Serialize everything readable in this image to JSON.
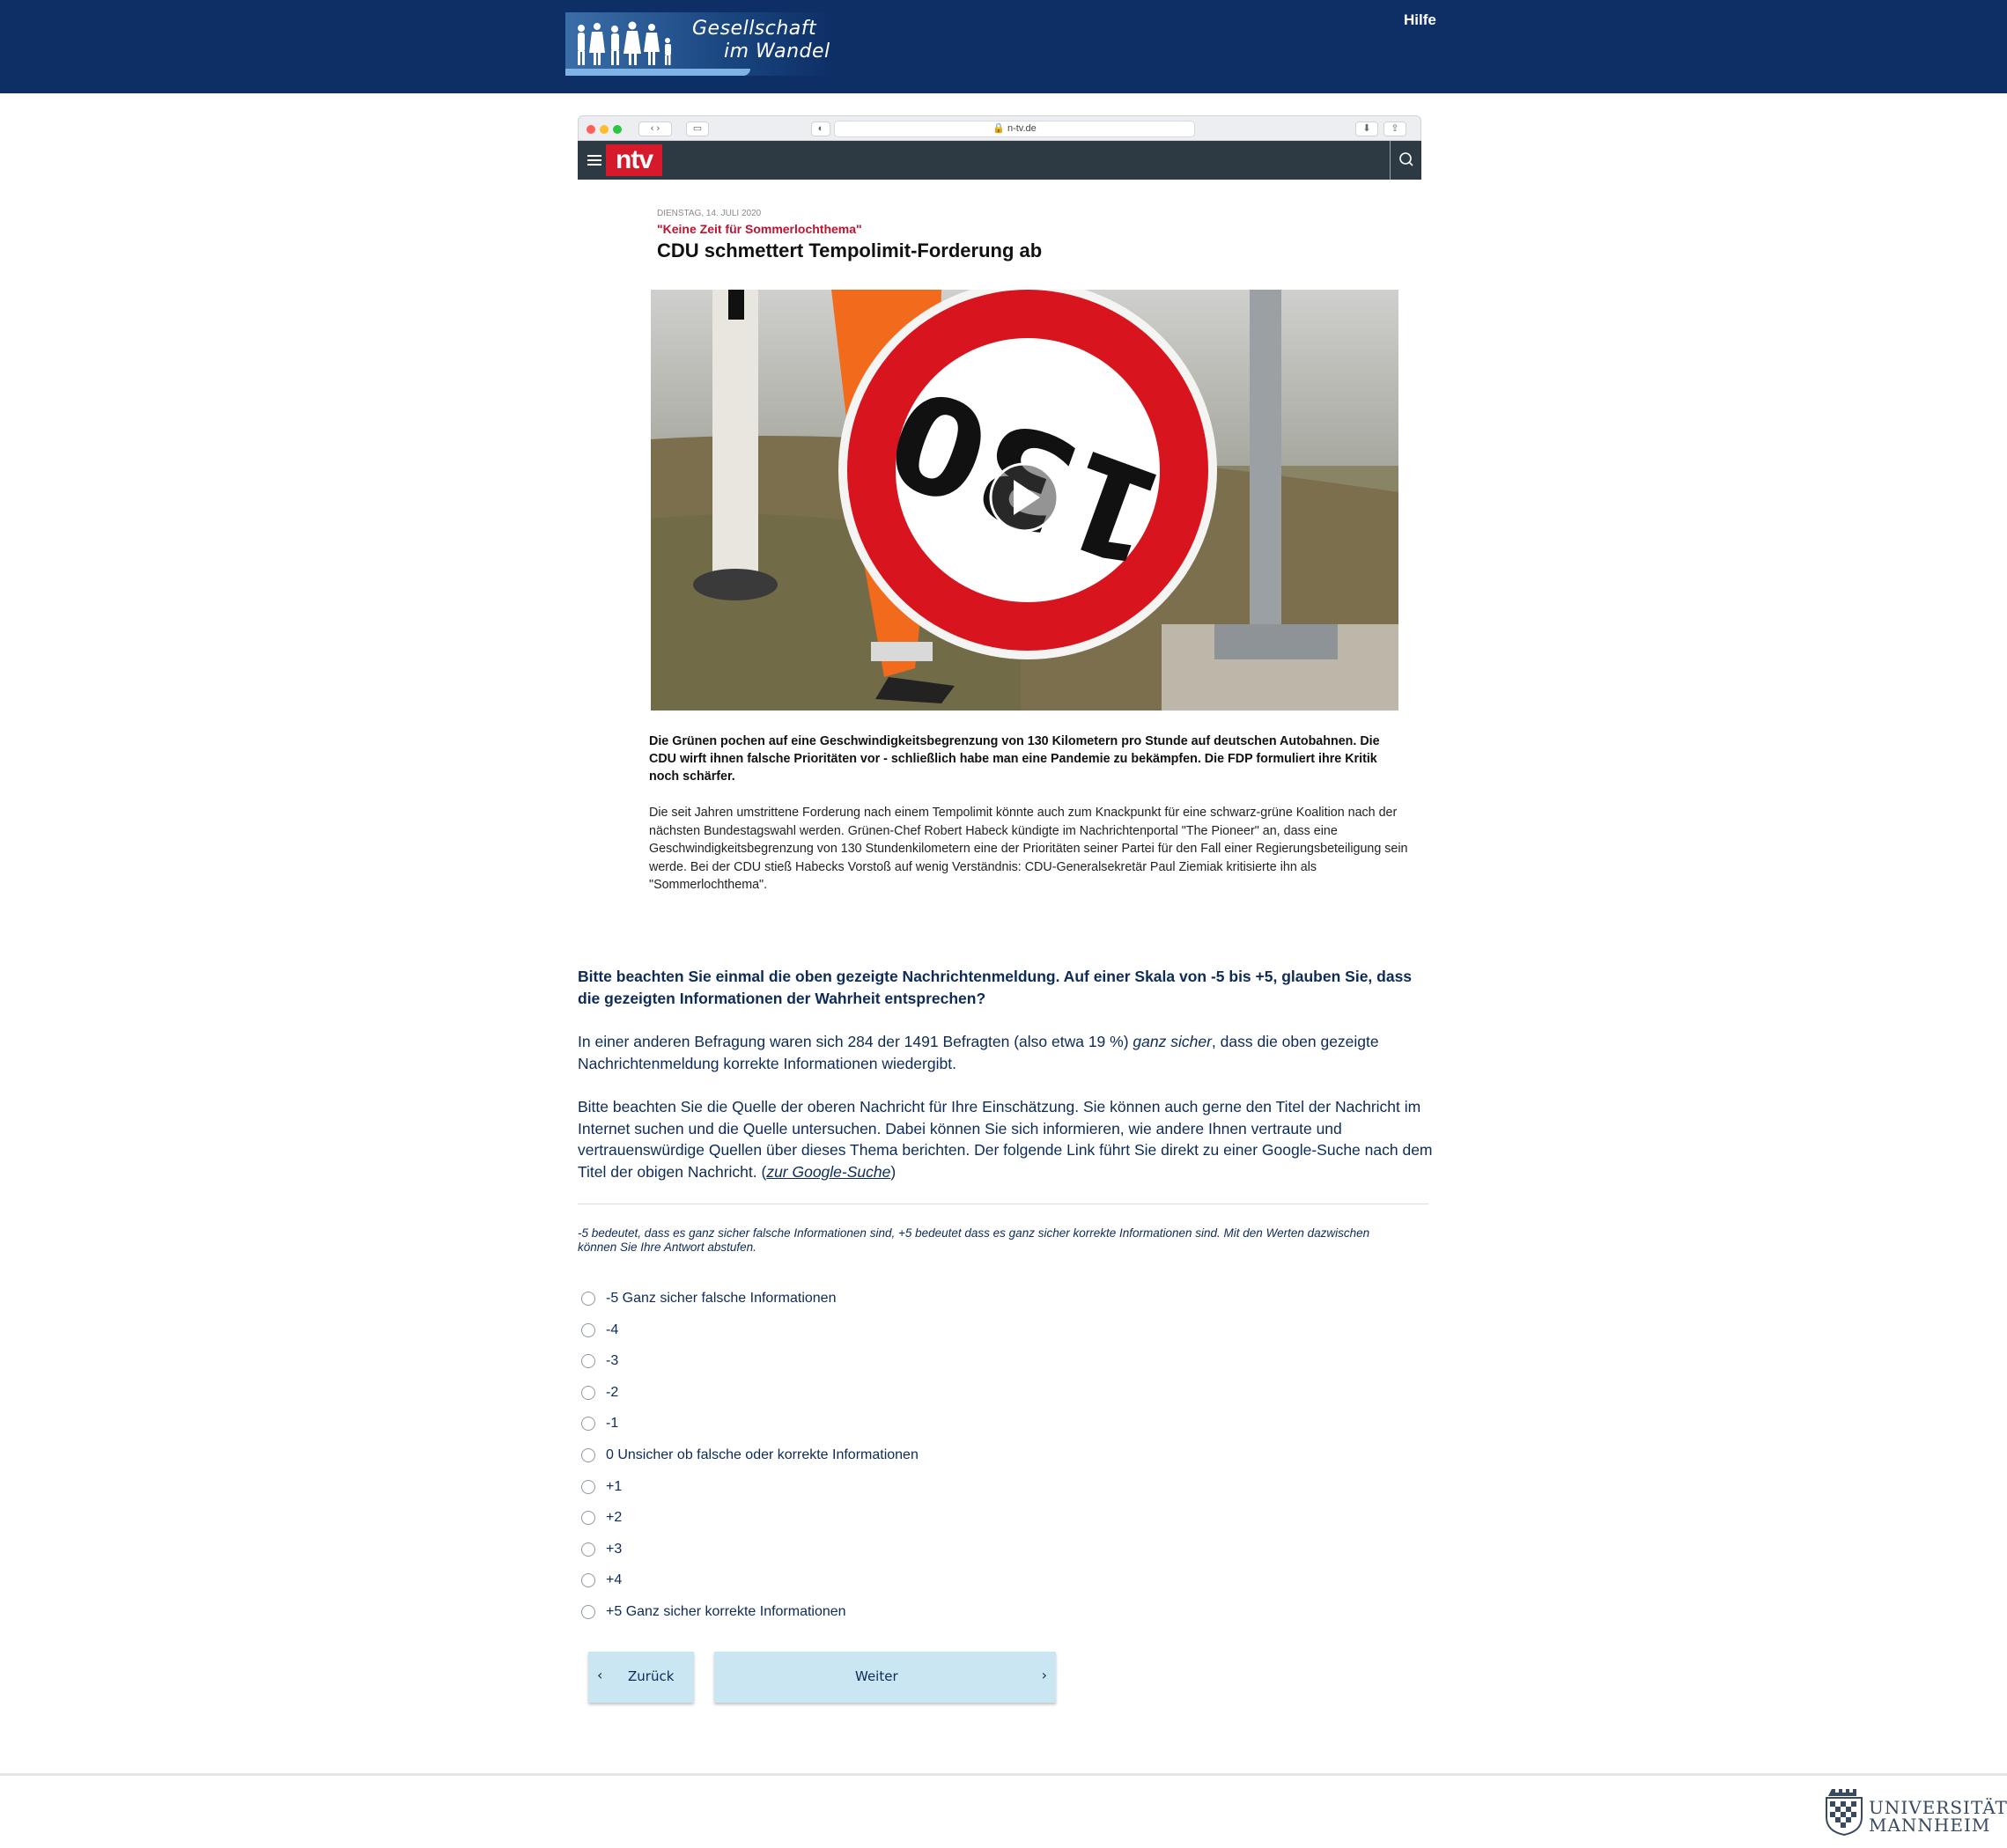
{
  "header": {
    "logo_line1": "Gesellschaft",
    "logo_line2": "im Wandel",
    "help_link": "Hilfe"
  },
  "browser": {
    "url": "n-tv.de",
    "site_logo": "ntv"
  },
  "article": {
    "date": "DIENSTAG, 14. JULI 2020",
    "kicker": "\"Keine Zeit für Sommerlochthema\"",
    "title": "CDU schmettert Tempolimit-Forderung ab",
    "sign_number": "130",
    "lead": "Die Grünen pochen auf eine Geschwindigkeitsbegrenzung von 130 Kilometern pro Stunde auf deutschen Autobahnen. Die CDU wirft ihnen falsche Prioritäten vor - schließlich habe man eine Pandemie zu bekämpfen. Die FDP formuliert ihre Kritik noch schärfer.",
    "body": "Die seit Jahren umstrittene Forderung nach einem Tempolimit könnte auch zum Knackpunkt für eine schwarz-grüne Koalition nach der nächsten Bundestagswahl werden. Grünen-Chef Robert Habeck kündigte im Nachrichtenportal \"The Pioneer\" an, dass eine Geschwindigkeitsbegrenzung von 130 Stundenkilometern eine der Prioritäten seiner Partei für den Fall einer Regierungsbeteiligung sein werde. Bei der CDU stieß Habecks Vorstoß auf wenig Verständnis: CDU-Generalsekretär Paul Ziemiak kritisierte ihn als \"Sommerlochthema\"."
  },
  "survey": {
    "question": "Bitte beachten Sie einmal die oben gezeigte Nachrichtenmeldung. Auf einer Skala von -5 bis +5, glauben Sie, dass die gezeigten Informationen der Wahrheit entsprechen?",
    "info_before": "In einer anderen Befragung waren sich 284 der 1491 Befragten (also etwa 19 %) ",
    "info_emph": "ganz sicher",
    "info_after": ", dass die oben gezeigte Nachrichtenmeldung korrekte Informationen wiedergibt.",
    "instruction": "Bitte beachten Sie die Quelle der oberen Nachricht für Ihre Einschätzung. Sie können auch gerne den Titel der Nachricht im Internet suchen und die Quelle untersuchen. Dabei können Sie sich informieren, wie andere Ihnen vertraute und vertrauenswürdige Quellen über dieses Thema berichten. Der folgende Link führt Sie direkt zu einer Google-Suche nach dem Titel der obigen Nachricht. (",
    "link_text": "zur Google-Suche",
    "instruction_end": ")",
    "hint": "-5 bedeutet, dass es ganz sicher falsche Informationen sind, +5 bedeutet dass es ganz sicher korrekte Informationen sind. Mit den Werten dazwischen können Sie Ihre Antwort abstufen.",
    "options": [
      "-5 Ganz sicher falsche Informationen",
      "-4",
      "-3",
      "-2",
      "-1",
      "0 Unsicher ob falsche oder korrekte Informationen",
      "+1",
      "+2",
      "+3",
      "+4",
      "+5 Ganz sicher korrekte Informationen"
    ],
    "back_label": "Zurück",
    "next_label": "Weiter"
  },
  "footer": {
    "uni_line1": "UNIVERSITÄT",
    "uni_line2": "MANNHEIM"
  },
  "colors": {
    "header_bg": "#0d2f66",
    "text": "#0d2b57",
    "button_bg": "#c9e6f2",
    "ntv_red": "#d61a2c",
    "kicker_red": "#c1122f"
  }
}
